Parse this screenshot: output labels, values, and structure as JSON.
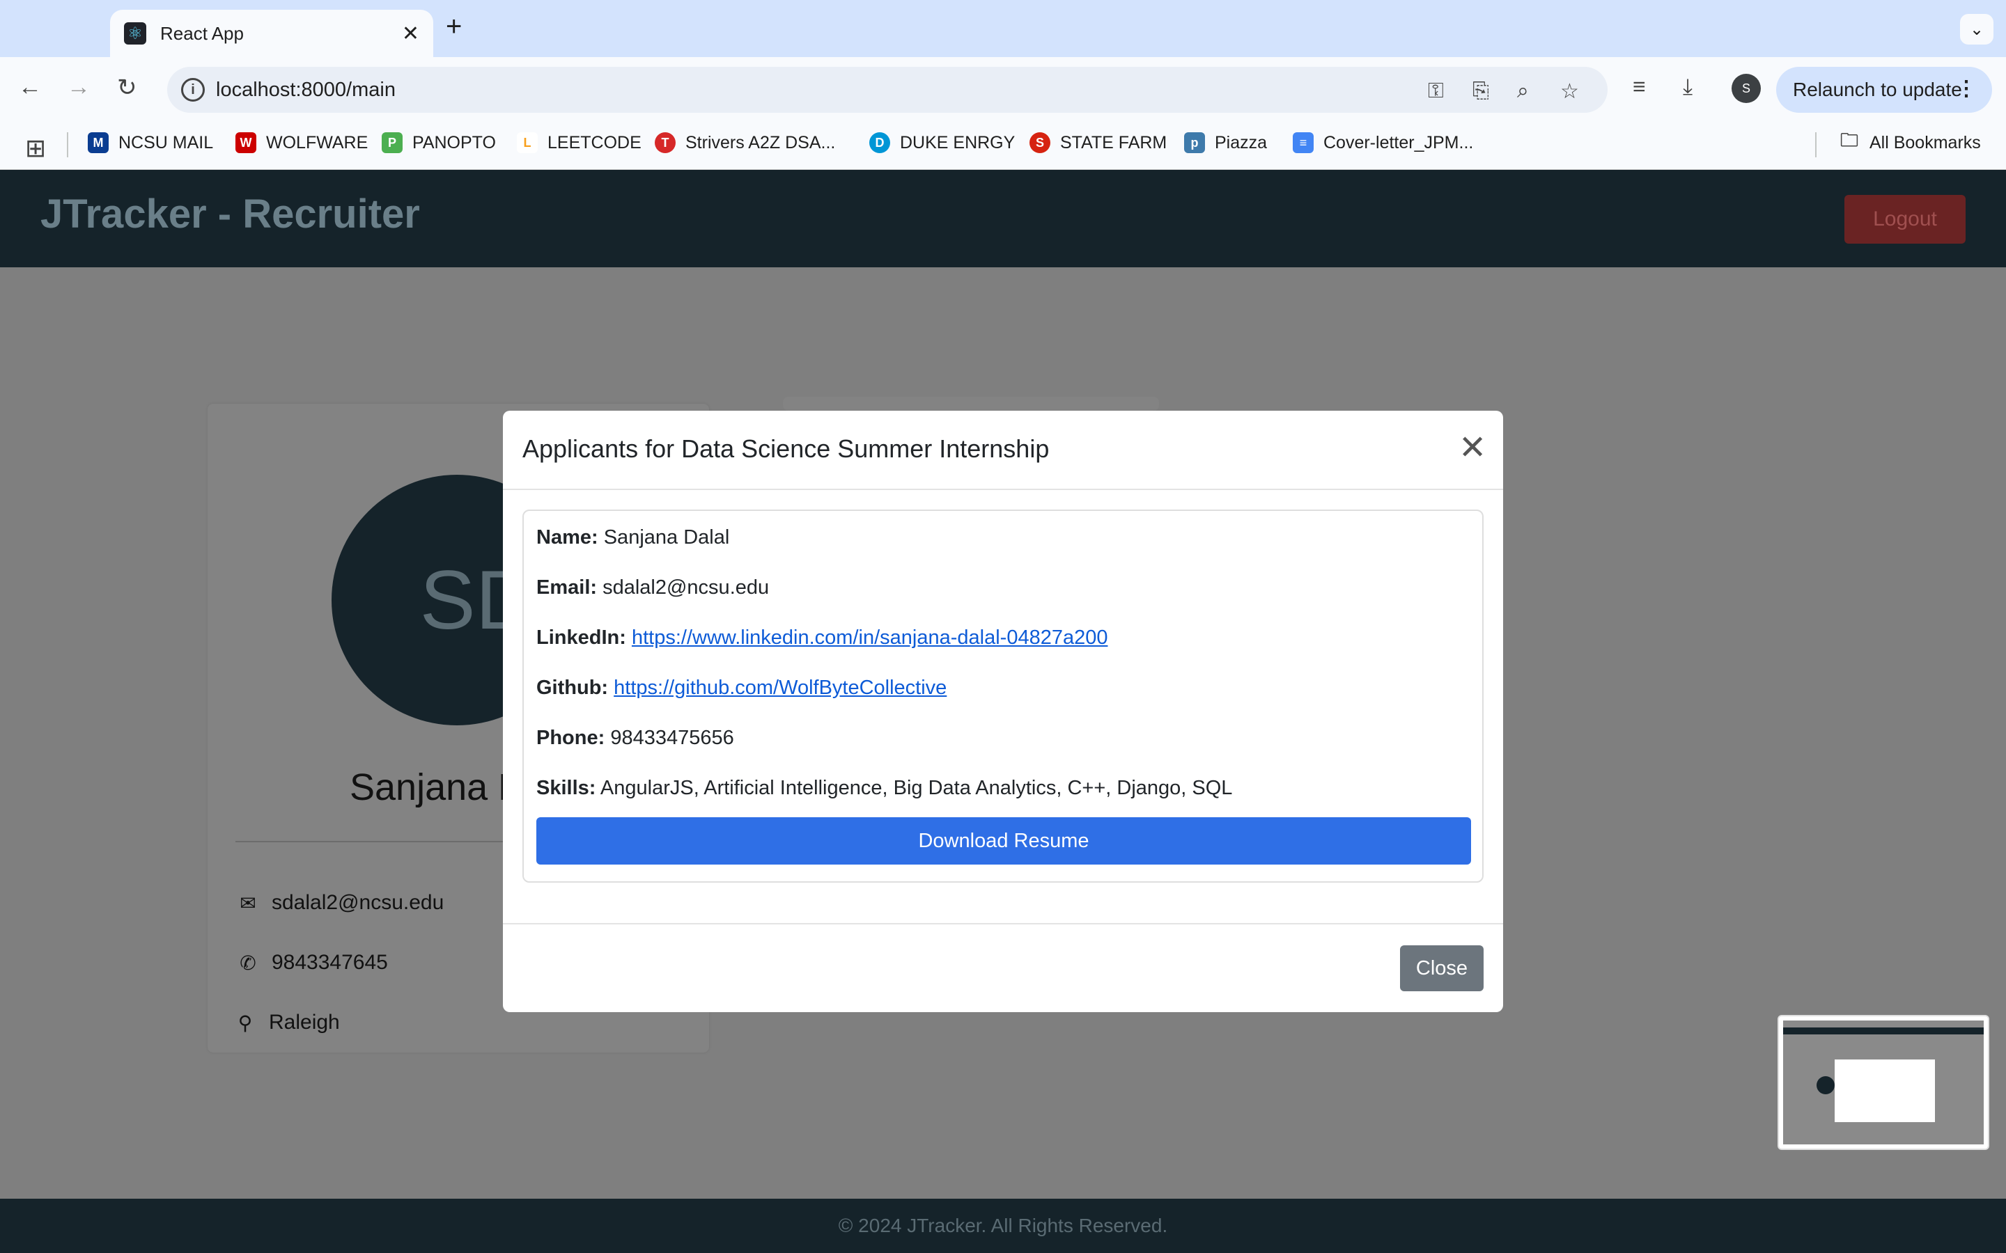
{
  "browser": {
    "tab_title": "React App",
    "url": "localhost:8000/main",
    "relaunch_label": "Relaunch to update",
    "profile_initial": "S",
    "new_tab_symbol": "+",
    "bookmarks": [
      {
        "label": "NCSU MAIL",
        "color": "#0b3d91"
      },
      {
        "label": "WOLFWARE",
        "color": "#cc0000"
      },
      {
        "label": "PANOPTO",
        "color": "#4caf50"
      },
      {
        "label": "LEETCODE",
        "color": "#f89f1b"
      },
      {
        "label": "Strivers A2Z DSA...",
        "color": "#d62828"
      },
      {
        "label": "DUKE ENRGY",
        "color": "#0096d6"
      },
      {
        "label": "STATE FARM",
        "color": "#d62311"
      },
      {
        "label": "Piazza",
        "color": "#3e7aab"
      },
      {
        "label": "Cover-letter_JPM...",
        "color": "#4285f4"
      }
    ],
    "all_bookmarks_label": "All Bookmarks"
  },
  "app": {
    "title": "JTracker - Recruiter",
    "logout_label": "Logout",
    "profile": {
      "initials": "SD",
      "name": "Sanjana D",
      "email": "sdalal2@ncsu.edu",
      "phone": "9843347645",
      "location": "Raleigh"
    },
    "footer": "© 2024 JTracker. All Rights Reserved."
  },
  "modal": {
    "title": "Applicants for Data Science Summer Internship",
    "close_symbol": "✕",
    "applicant": {
      "name_label": "Name:",
      "name": "Sanjana Dalal",
      "email_label": "Email:",
      "email": "sdalal2@ncsu.edu",
      "linkedin_label": "LinkedIn:",
      "linkedin": "https://www.linkedin.com/in/sanjana-dalal-04827a200",
      "github_label": "Github:",
      "github": "https://github.com/WolfByteCollective",
      "phone_label": "Phone:",
      "phone": "98433475656",
      "skills_label": "Skills:",
      "skills": "AngularJS, Artificial Intelligence, Big Data Analytics, C++, Django, SQL",
      "download_label": "Download Resume"
    },
    "close_label": "Close"
  }
}
